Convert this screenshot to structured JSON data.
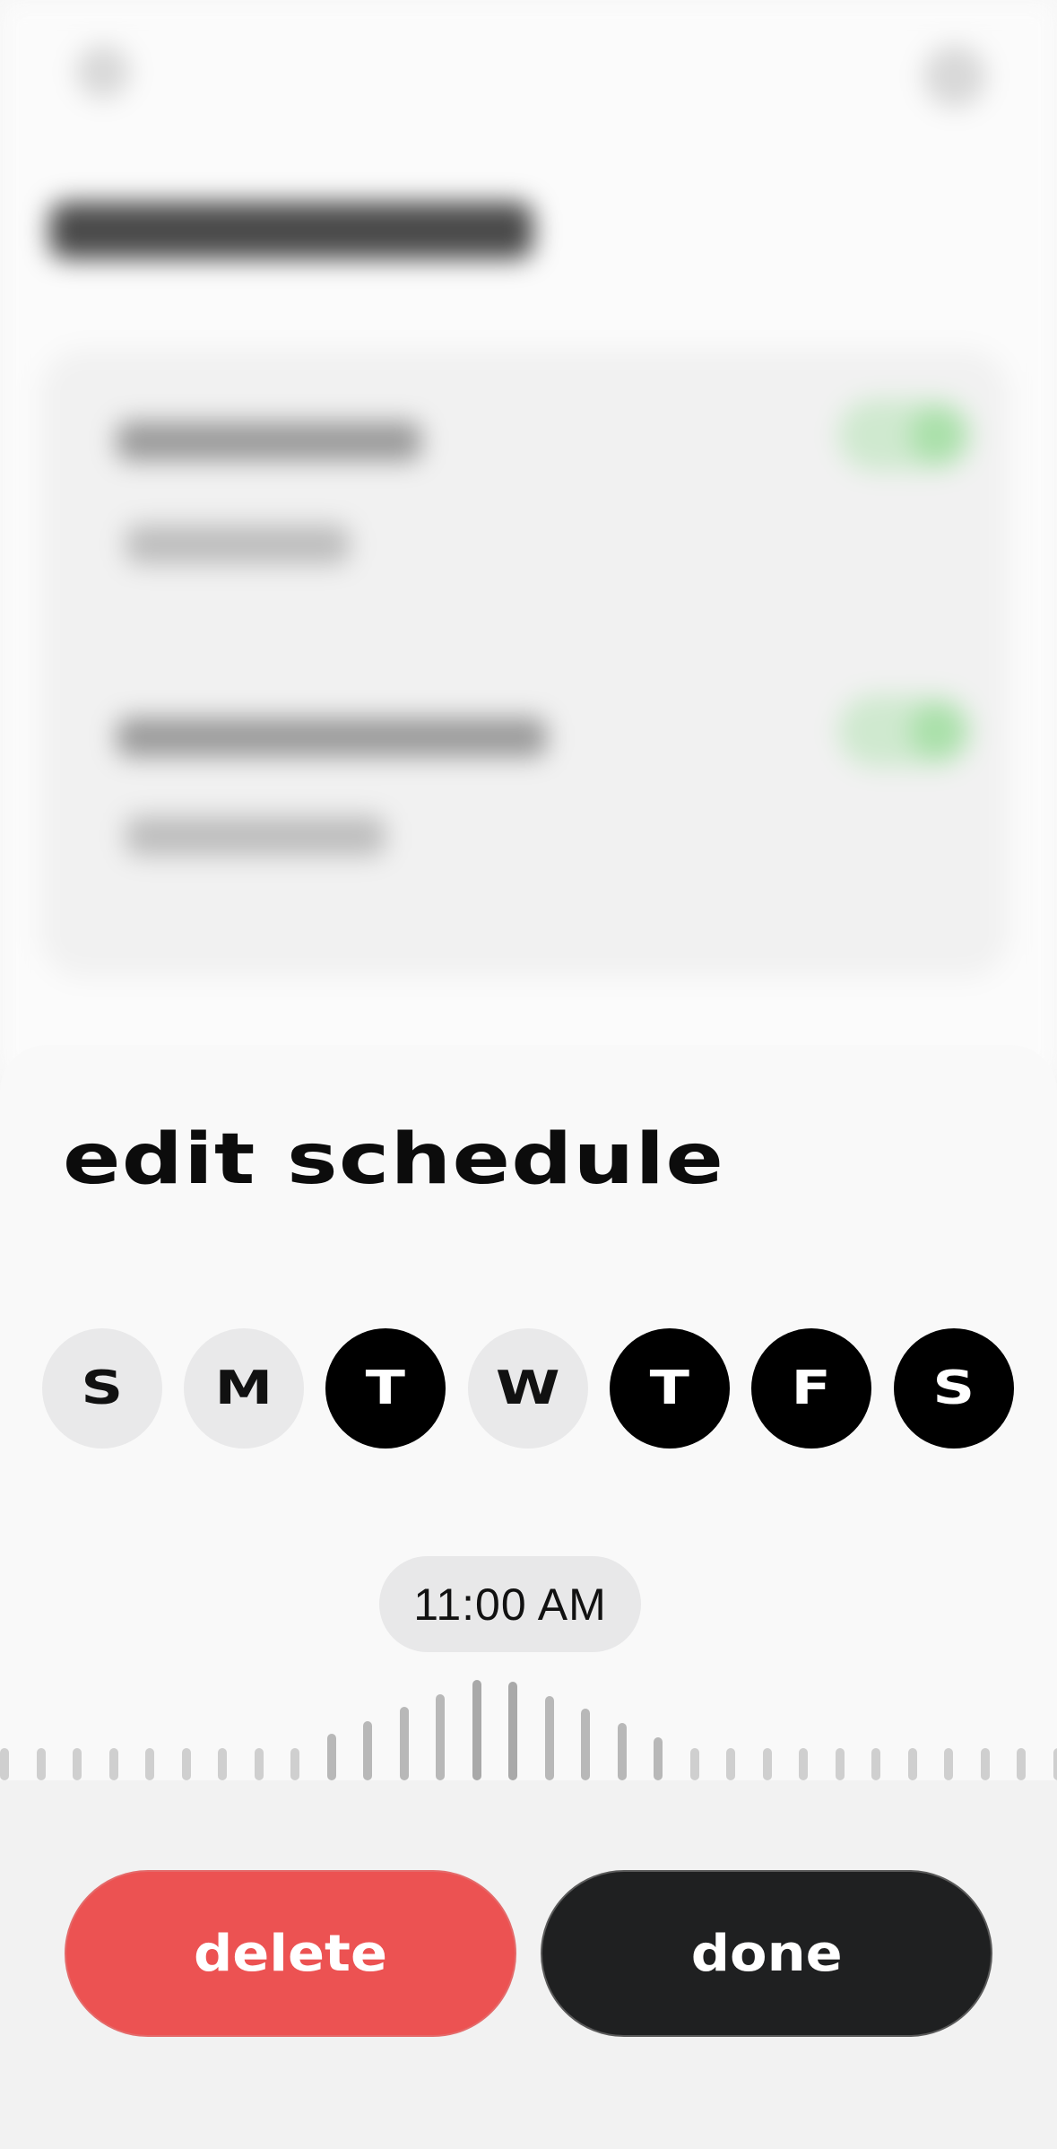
{
  "sheet": {
    "title": "edit schedule"
  },
  "days": [
    {
      "label": "S",
      "selected": false
    },
    {
      "label": "M",
      "selected": false
    },
    {
      "label": "T",
      "selected": true
    },
    {
      "label": "W",
      "selected": false
    },
    {
      "label": "T",
      "selected": true
    },
    {
      "label": "F",
      "selected": true
    },
    {
      "label": "S",
      "selected": true
    }
  ],
  "time_picker": {
    "value": "11:00 AM"
  },
  "actions": {
    "delete_label": "delete",
    "done_label": "done"
  },
  "colors": {
    "delete": "#ec5252",
    "done": "#1f2021",
    "day_selected": "#000000",
    "day_unselected": "#e9e9ea"
  }
}
